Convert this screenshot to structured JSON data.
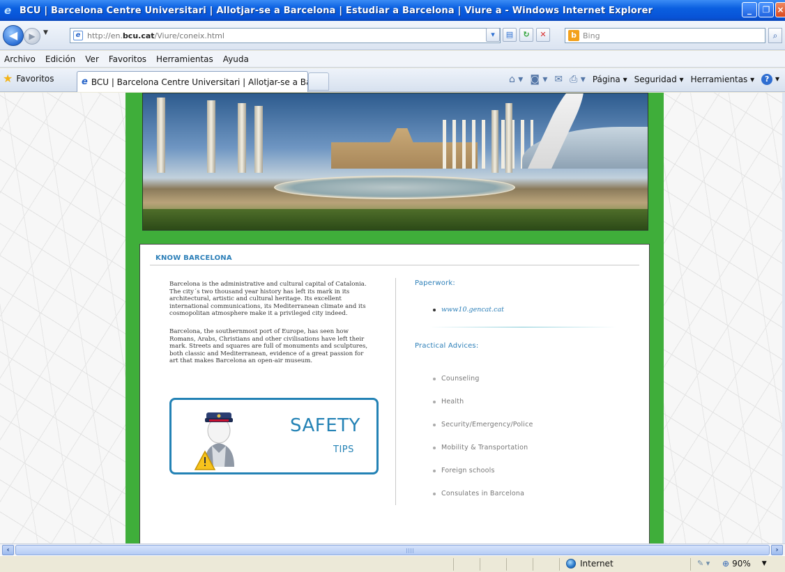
{
  "window": {
    "title": "BCU | Barcelona Centre Universitari | Allotjar-se a Barcelona | Estudiar a Barcelona | Viure a  - Windows Internet Explorer"
  },
  "address_bar": {
    "url_prefix": "http://en.",
    "url_domain": "bcu.cat",
    "url_path": "/Viure/coneix.html",
    "search_placeholder": "Bing"
  },
  "menu": {
    "items": [
      "Archivo",
      "Edición",
      "Ver",
      "Favoritos",
      "Herramientas",
      "Ayuda"
    ]
  },
  "favorites_bar": {
    "favorites_label": "Favoritos",
    "tab_title": "BCU | Barcelona Centre Universitari | Allotjar-se a Bar...",
    "command_items": [
      "Página",
      "Seguridad",
      "Herramientas"
    ]
  },
  "page": {
    "section_title": "KNOW BARCELONA",
    "paragraphs": [
      "Barcelona is the administrative and cultural capital of Catalonia. The city´s two thousand year history has left its mark in its architectural, artistic and cultural heritage. Its excellent international communications, its Mediterranean climate and its cosmopolitan atmosphere make it a privileged city indeed.",
      "Barcelona, the southernmost port of Europe, has seen how Romans, Arabs, Christians and other civilisations have left their mark. Streets and squares are full of monuments and sculptures, both classic and Mediterranean, evidence of a great passion for art that makes Barcelona an open-air museum."
    ],
    "safety_banner": {
      "word": "SAFETY",
      "sub": "TIPS"
    },
    "paperwork_heading": "Paperwork:",
    "paperwork_link": "www10.gencat.cat",
    "practical_heading": "Practical Advices:",
    "advices": [
      "Counseling",
      "Health",
      "Security/Emergency/Police",
      "Mobility & Transportation",
      "Foreign schools",
      "Consulates in Barcelona"
    ]
  },
  "status_bar": {
    "zone": "Internet",
    "zoom": "90%"
  },
  "colors": {
    "frame_green": "#3fae3a",
    "heading_blue": "#2c7fb8",
    "title_bar_blue": "#0a5fe0"
  }
}
